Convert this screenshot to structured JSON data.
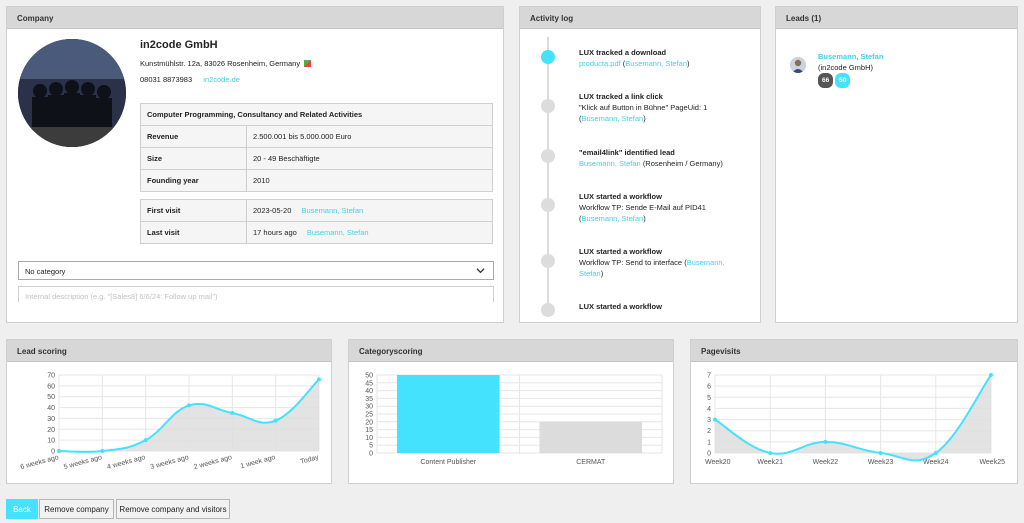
{
  "company": {
    "panel_title": "Company",
    "name": "in2code GmbH",
    "address": "Kunstmühlstr. 12a, 83026 Rosenheim, Germany",
    "phone": "08031 8873983",
    "website": "in2code.de",
    "branch": "Computer Programming, Consultancy and Related Activities",
    "facts": [
      {
        "key": "Revenue",
        "value": "2.500.001 bis 5.000.000 Euro"
      },
      {
        "key": "Size",
        "value": "20 - 49 Beschäftigte"
      },
      {
        "key": "Founding year",
        "value": "2010"
      }
    ],
    "visits": [
      {
        "key": "First visit",
        "value": "2023-05-20",
        "visitor": "Busemann, Stefan"
      },
      {
        "key": "Last visit",
        "value": "17 hours ago",
        "visitor": "Busemann, Stefan"
      }
    ],
    "category_selected": "No category",
    "description_placeholder": "Internal description (e.g. \"[Sales8] 6/6/24: Follow up mail\")"
  },
  "activity": {
    "panel_title": "Activity log",
    "items": [
      {
        "title": "LUX tracked a download",
        "text": "",
        "link": "producta.pdf",
        "person": "Busemann, Stefan",
        "active": true
      },
      {
        "title": "LUX tracked a link click",
        "text": "\"Klick auf Button in Bühne\" PageUid: 1",
        "link": "",
        "person": "Busemann, Stefan",
        "active": false
      },
      {
        "title": "\"email4link\" identified lead",
        "text": "",
        "link": "",
        "person": "Busemann, Stefan",
        "suffix": "(Rosenheim / Germany)",
        "active": false
      },
      {
        "title": "LUX started a workflow",
        "text": "Workflow TP: Sende E-Mail auf PID41",
        "link": "",
        "person": "Busemann, Stefan",
        "active": false
      },
      {
        "title": "LUX started a workflow",
        "text": "Workflow TP: Send to interface",
        "link": "",
        "person": "Busemann, Stefan",
        "active": false
      },
      {
        "title": "LUX started a workflow",
        "text": "",
        "link": "",
        "person": "",
        "active": false
      }
    ]
  },
  "leads": {
    "panel_title": "Leads (1)",
    "items": [
      {
        "name": "Busemann, Stefan",
        "company": "(in2code GmbH)",
        "badge_a": "66",
        "badge_b": "50"
      }
    ]
  },
  "colors": {
    "accent": "#44e2fc",
    "dark_badge": "#555555",
    "grey_bar": "#dcdcdc"
  },
  "charts": {
    "lead_scoring_title": "Lead scoring",
    "category_scoring_title": "Categoryscoring",
    "pagevisits_title": "Pagevisits"
  },
  "chart_data": [
    {
      "type": "area",
      "x": [
        "6 weeks ago",
        "5 weeks ago",
        "4 weeks ago",
        "3 weeks ago",
        "2 weeks ago",
        "1 week ago",
        "Today"
      ],
      "values": [
        0,
        0,
        10,
        42,
        35,
        28,
        66
      ],
      "ylim": [
        0,
        70
      ],
      "yticks": [
        0,
        10,
        20,
        30,
        40,
        50,
        60,
        70
      ],
      "grid": true
    },
    {
      "type": "bar",
      "categories": [
        "Content Publisher",
        "CERMAT"
      ],
      "values": [
        50,
        20
      ],
      "ylim": [
        0,
        50
      ],
      "yticks": [
        0,
        5,
        10,
        15,
        20,
        25,
        30,
        35,
        40,
        45,
        50
      ],
      "grid": true
    },
    {
      "type": "area",
      "x": [
        "Week20",
        "Week21",
        "Week22",
        "Week23",
        "Week24",
        "Week25"
      ],
      "values": [
        3,
        0,
        1,
        0,
        0,
        7
      ],
      "ylim": [
        0,
        7
      ],
      "yticks": [
        0,
        1,
        2,
        3,
        4,
        5,
        6,
        7
      ],
      "grid": true
    }
  ],
  "buttons": {
    "back": "Back",
    "remove_company": "Remove company",
    "remove_company_visitors": "Remove company and visitors"
  }
}
